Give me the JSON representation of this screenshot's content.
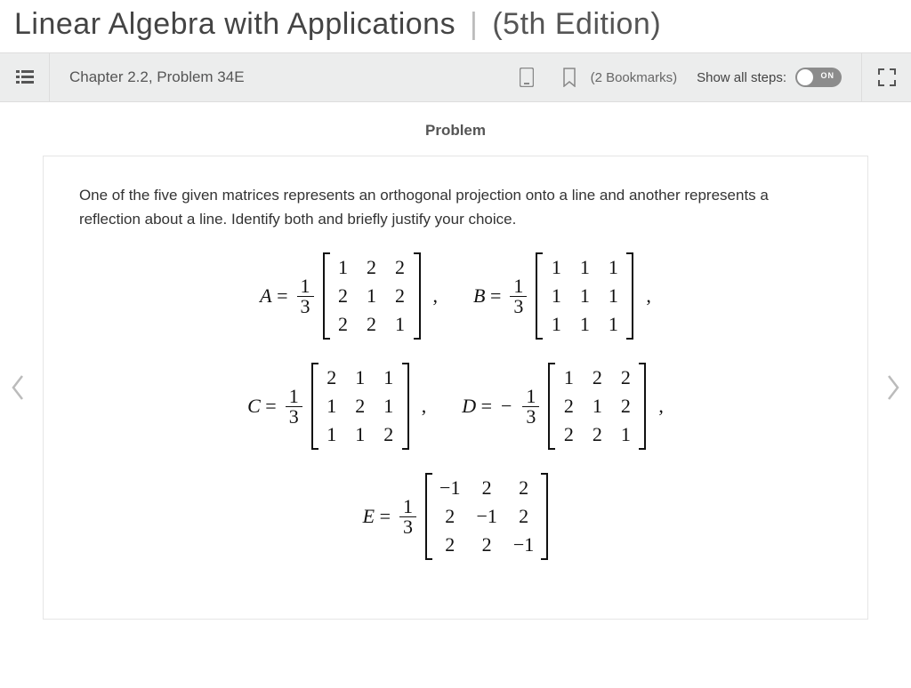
{
  "header": {
    "title": "Linear Algebra with Applications",
    "divider": "|",
    "edition": "(5th Edition)"
  },
  "toolbar": {
    "chapter_label": "Chapter 2.2, Problem 34E",
    "bookmarks_text": "(2 Bookmarks)",
    "steps_label": "Show all steps:",
    "toggle_label": "ON"
  },
  "section": {
    "title": "Problem"
  },
  "problem": {
    "intro": "One of the five given matrices represents an orthogonal projection onto a line and another represents a reflection about a line. Identify both and briefly justify your choice.",
    "scalar_num": "1",
    "scalar_den": "3",
    "neg_sign": "−",
    "matrices": {
      "A": {
        "label": "A",
        "rows": [
          [
            "1",
            "2",
            "2"
          ],
          [
            "2",
            "1",
            "2"
          ],
          [
            "2",
            "2",
            "1"
          ]
        ]
      },
      "B": {
        "label": "B",
        "rows": [
          [
            "1",
            "1",
            "1"
          ],
          [
            "1",
            "1",
            "1"
          ],
          [
            "1",
            "1",
            "1"
          ]
        ]
      },
      "C": {
        "label": "C",
        "rows": [
          [
            "2",
            "1",
            "1"
          ],
          [
            "1",
            "2",
            "1"
          ],
          [
            "1",
            "1",
            "2"
          ]
        ]
      },
      "D": {
        "label": "D",
        "rows": [
          [
            "1",
            "2",
            "2"
          ],
          [
            "2",
            "1",
            "2"
          ],
          [
            "2",
            "2",
            "1"
          ]
        ],
        "neg_scalar": true
      },
      "E": {
        "label": "E",
        "rows": [
          [
            "−1",
            "2",
            "2"
          ],
          [
            "2",
            "−1",
            "2"
          ],
          [
            "2",
            "2",
            "−1"
          ]
        ]
      }
    }
  }
}
